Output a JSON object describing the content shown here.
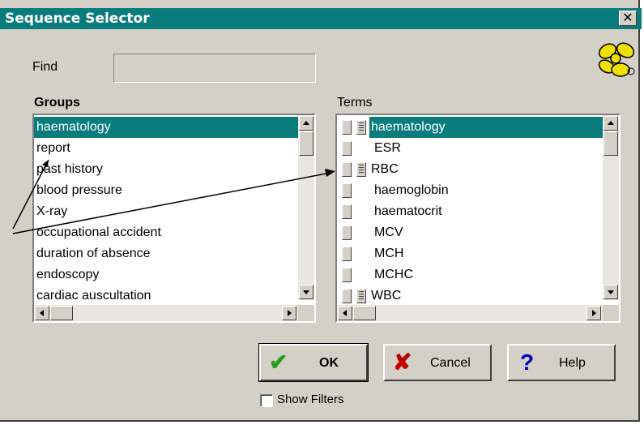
{
  "window": {
    "title": "Sequence Selector",
    "close_glyph": "✕"
  },
  "find": {
    "label": "Find",
    "value": ""
  },
  "groups": {
    "label": "Groups",
    "items": [
      {
        "label": "haematology",
        "selected": true
      },
      {
        "label": "report"
      },
      {
        "label": "past history"
      },
      {
        "label": "blood pressure"
      },
      {
        "label": "X-ray"
      },
      {
        "label": "occupational accident"
      },
      {
        "label": "duration of absence"
      },
      {
        "label": "endoscopy"
      },
      {
        "label": "cardiac auscultation"
      }
    ]
  },
  "terms": {
    "label": "Terms",
    "items": [
      {
        "label": "haematology",
        "expandable": true,
        "selected": true
      },
      {
        "label": "ESR"
      },
      {
        "label": "RBC",
        "expandable": true
      },
      {
        "label": "haemoglobin"
      },
      {
        "label": "haematocrit"
      },
      {
        "label": "MCV"
      },
      {
        "label": "MCH"
      },
      {
        "label": "MCHC"
      },
      {
        "label": "WBC",
        "expandable": true
      }
    ]
  },
  "buttons": {
    "ok": "OK",
    "cancel": "Cancel",
    "help": "Help"
  },
  "icons": {
    "ok": "check-icon",
    "cancel": "x-icon",
    "help": "question-icon",
    "logo": "orchid-logo-icon"
  },
  "show_filters": {
    "label": "Show Filters",
    "checked": false
  },
  "colors": {
    "selection": "#0a7c7c",
    "title_bar": "#0a7c7c",
    "ok_icon": "#2e9e1e",
    "cancel_icon": "#c00000",
    "help_icon": "#0000c0",
    "logo": "#f0e000"
  }
}
